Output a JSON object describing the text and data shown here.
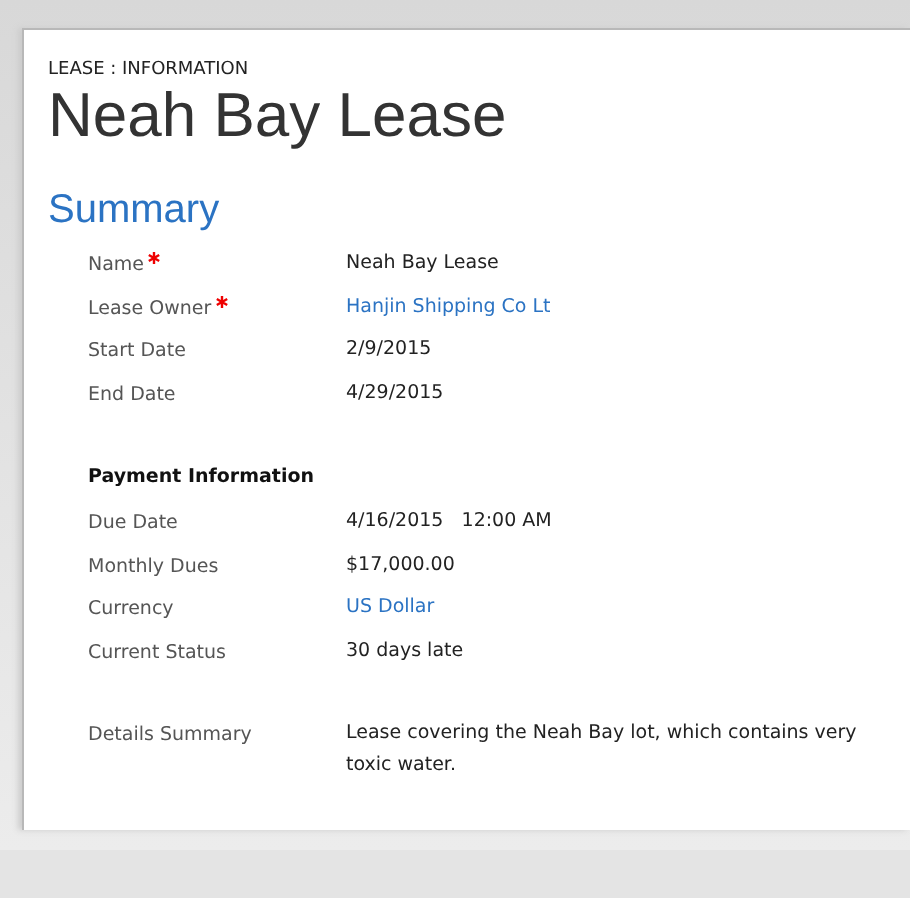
{
  "entity_label": "LEASE : INFORMATION",
  "title": "Neah Bay Lease",
  "section": {
    "title": "Summary",
    "groups": [
      {
        "fields": [
          {
            "label": "Name",
            "required": true,
            "kind": "text",
            "value": "Neah Bay Lease"
          },
          {
            "label": "Lease Owner",
            "required": true,
            "kind": "link",
            "value": "Hanjin Shipping Co Lt"
          },
          {
            "label": "Start Date",
            "required": false,
            "kind": "text",
            "value": "2/9/2015"
          },
          {
            "label": "End Date",
            "required": false,
            "kind": "text",
            "value": "4/29/2015"
          }
        ]
      },
      {
        "heading": "Payment Information",
        "fields": [
          {
            "label": "Due Date",
            "required": false,
            "kind": "text",
            "value": "4/16/2015   12:00 AM"
          },
          {
            "label": "Monthly Dues",
            "required": false,
            "kind": "text",
            "value": "$17,000.00"
          },
          {
            "label": "Currency",
            "required": false,
            "kind": "link",
            "value": "US Dollar"
          },
          {
            "label": "Current Status",
            "required": false,
            "kind": "text",
            "value": "30 days late"
          }
        ]
      },
      {
        "fields": [
          {
            "label": "Details Summary",
            "required": false,
            "kind": "text",
            "value": "Lease covering the Neah Bay lot, which contains very toxic water."
          }
        ]
      }
    ]
  }
}
